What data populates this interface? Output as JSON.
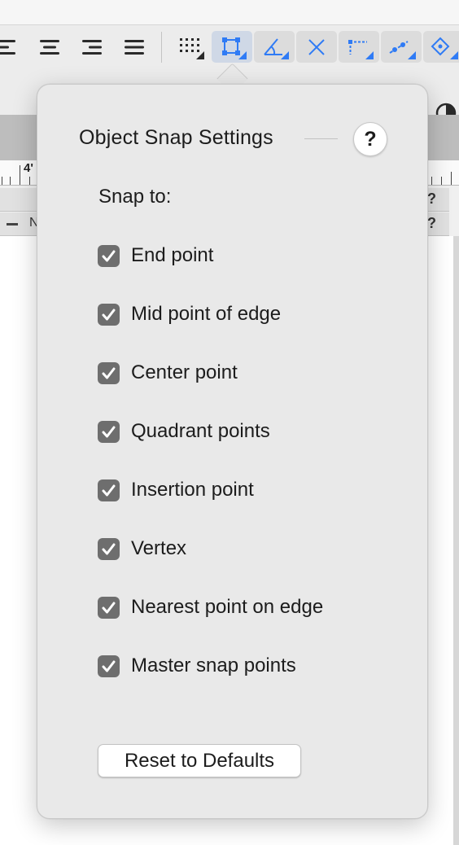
{
  "background": {
    "ruler_number": "4'",
    "row_q1": "?",
    "row_q2": "?",
    "row_text": "N",
    "toolbar_icons": [
      "align-left-icon",
      "align-center-icon",
      "align-right-icon",
      "justify-icon",
      "grid-snap-icon",
      "object-snap-icon",
      "angle-snap-icon",
      "intersection-snap-icon",
      "distance-snap-icon",
      "smart-point-icon",
      "constraint-icon"
    ],
    "accent_color": "#2f7bf5"
  },
  "popover": {
    "title": "Object Snap Settings",
    "help_label": "?",
    "snap_to_label": "Snap to:",
    "options": [
      {
        "label": "End point",
        "checked": true
      },
      {
        "label": "Mid point of edge",
        "checked": true
      },
      {
        "label": "Center point",
        "checked": true
      },
      {
        "label": "Quadrant points",
        "checked": true
      },
      {
        "label": "Insertion point",
        "checked": true
      },
      {
        "label": "Vertex",
        "checked": true
      },
      {
        "label": "Nearest point on edge",
        "checked": true
      },
      {
        "label": "Master snap points",
        "checked": true
      }
    ],
    "reset_label": "Reset to Defaults"
  }
}
